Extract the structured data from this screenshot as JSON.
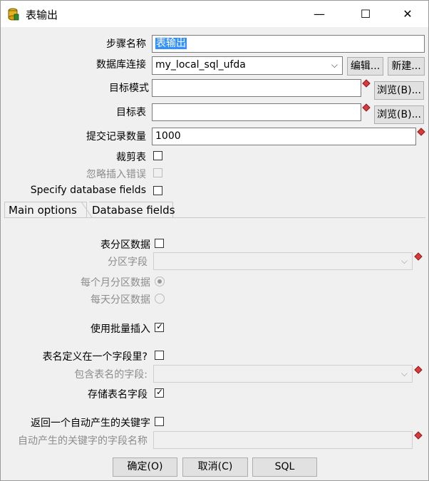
{
  "window": {
    "title": "表输出",
    "minimize": "—",
    "maximize": "☐",
    "close": "✕"
  },
  "form": {
    "step_name_label": "步骤名称",
    "step_name_value": "表输出",
    "connection_label": "数据库连接",
    "connection_value": "my_local_sql_ufda",
    "edit_button": "编辑...",
    "new_button": "新建...",
    "target_schema_label": "目标模式",
    "target_schema_value": "",
    "browse_schema_button": "浏览(B)...",
    "target_table_label": "目标表",
    "target_table_value": "",
    "browse_table_button": "浏览(B)...",
    "commit_size_label": "提交记录数量",
    "commit_size_value": "1000",
    "truncate_label": "裁剪表",
    "ignore_errors_label": "忽略插入错误",
    "specify_fields_label": "Specify database fields"
  },
  "tabs": [
    {
      "label": "Main options",
      "active": true
    },
    {
      "label": "Database fields",
      "active": false
    }
  ],
  "main_options": {
    "partition_label": "表分区数据",
    "partition_field_label": "分区字段",
    "partition_field_value": "",
    "monthly_label": "每个月分区数据",
    "daily_label": "每天分区数据",
    "batch_insert_label": "使用批量插入",
    "batch_insert_checked": true,
    "table_in_field_label": "表名定义在一个字段里?",
    "table_field_label": "包含表名的字段:",
    "table_field_value": "",
    "store_table_field_label": "存储表名字段",
    "store_table_field_checked": true,
    "return_key_label": "返回一个自动产生的关键字",
    "key_field_label": "自动产生的关键字的字段名称",
    "key_field_value": ""
  },
  "buttons": {
    "ok": "确定(O)",
    "cancel": "取消(C)",
    "sql": "SQL"
  },
  "colors": {
    "selection": "#3390ff",
    "required_marker": "#d83b3b"
  }
}
